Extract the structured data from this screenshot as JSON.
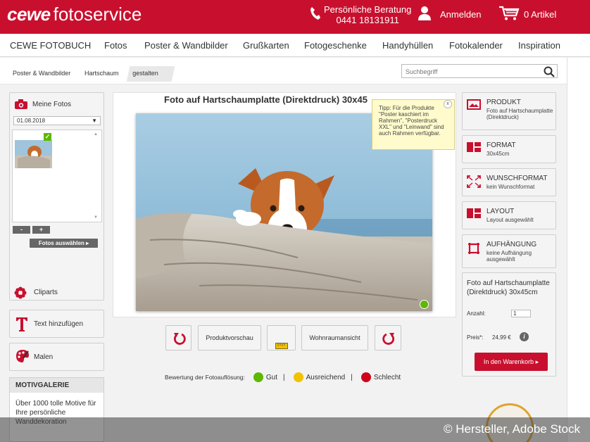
{
  "header": {
    "logo_brand": "cewe",
    "logo_service": "fotoservice",
    "hotline_label": "Persönliche Beratung",
    "hotline_number": "0441 18131911",
    "login_label": "Anmelden",
    "cart_label": "0 Artikel"
  },
  "nav": {
    "items": [
      "CEWE FOTOBUCH",
      "Fotos",
      "Poster & Wandbilder",
      "Grußkarten",
      "Fotogeschenke",
      "Handyhüllen",
      "Fotokalender",
      "Inspiration"
    ]
  },
  "breadcrumb": {
    "items": [
      "Poster & Wandbilder",
      "Hartschaum",
      "gestalten"
    ]
  },
  "search": {
    "placeholder": "Suchbegriff"
  },
  "left": {
    "my_photos_title": "Meine Fotos",
    "date_value": "01.08.2018",
    "minus_label": "-",
    "plus_label": "+",
    "select_photos_label": "Fotos auswählen",
    "cliparts_label": "Cliparts",
    "add_text_label": "Text hinzufügen",
    "paint_label": "Malen",
    "motiv_title": "MOTIVGALERIE",
    "motiv_text": "Über 1000 tolle Motive für Ihre persönliche Wanddekoration"
  },
  "center": {
    "product_title": "Foto auf Hartschaumplatte (Direktdruck) 30x45",
    "tip_text": "Tipp: Für die Produkte \"Poster kaschiert im Rahmen\", \"Posterdruck XXL\" und \"Leinwand\" sind auch Rahmen verfügbar.",
    "tip_close": "x",
    "preview_label": "Produktvorschau",
    "room_view_label": "Wohnraumansicht",
    "rating_label": "Bewertung der Fotoauflösung:",
    "rating_good": "Gut",
    "rating_ok": "Ausreichend",
    "rating_bad": "Schlecht",
    "rating_sep": "|"
  },
  "right": {
    "product": {
      "title": "PRODUKT",
      "value": "Foto auf Hartschaumplatte (Direktdruck)"
    },
    "format": {
      "title": "FORMAT",
      "value": "30x45cm"
    },
    "custom_format": {
      "title": "WUNSCHFORMAT",
      "value": "kein Wunschformat"
    },
    "layout": {
      "title": "LAYOUT",
      "value": "Layout ausgewählt"
    },
    "hanging": {
      "title": "AUFHÄNGUNG",
      "value": "keine Aufhängung ausgewählt"
    },
    "summary_title": "Foto auf Hartschaumplatte (Direktdruck) 30x45cm",
    "qty_label": "Anzahl:",
    "qty_value": "1",
    "price_label": "Preis*:",
    "price_value": "24,99 €",
    "cart_button": "In den Warenkorb"
  },
  "credit": "© Hersteller, Adobe Stock",
  "colors": {
    "brand_red": "#c8102e",
    "good_green": "#5cb800",
    "ok_yellow": "#f2c200",
    "bad_red": "#d0021b"
  }
}
